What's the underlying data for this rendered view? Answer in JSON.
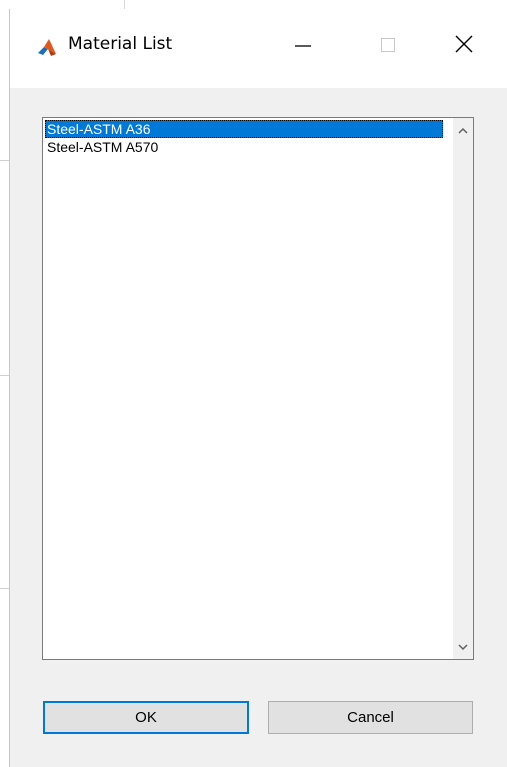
{
  "window": {
    "title": "Material List",
    "icon": "matlab-icon"
  },
  "titlebar": {
    "minimize_icon": "minimize-icon",
    "maximize_icon": "maximize-icon",
    "close_icon": "close-icon"
  },
  "listbox": {
    "items": [
      {
        "label": "Steel-ASTM A36",
        "selected": true
      },
      {
        "label": "Steel-ASTM A570",
        "selected": false
      }
    ],
    "scroll_up_icon": "chevron-up-icon",
    "scroll_down_icon": "chevron-down-icon"
  },
  "buttons": {
    "ok_label": "OK",
    "cancel_label": "Cancel"
  },
  "colors": {
    "selection": "#0078d7",
    "dialog_bg": "#f0f0f0"
  }
}
